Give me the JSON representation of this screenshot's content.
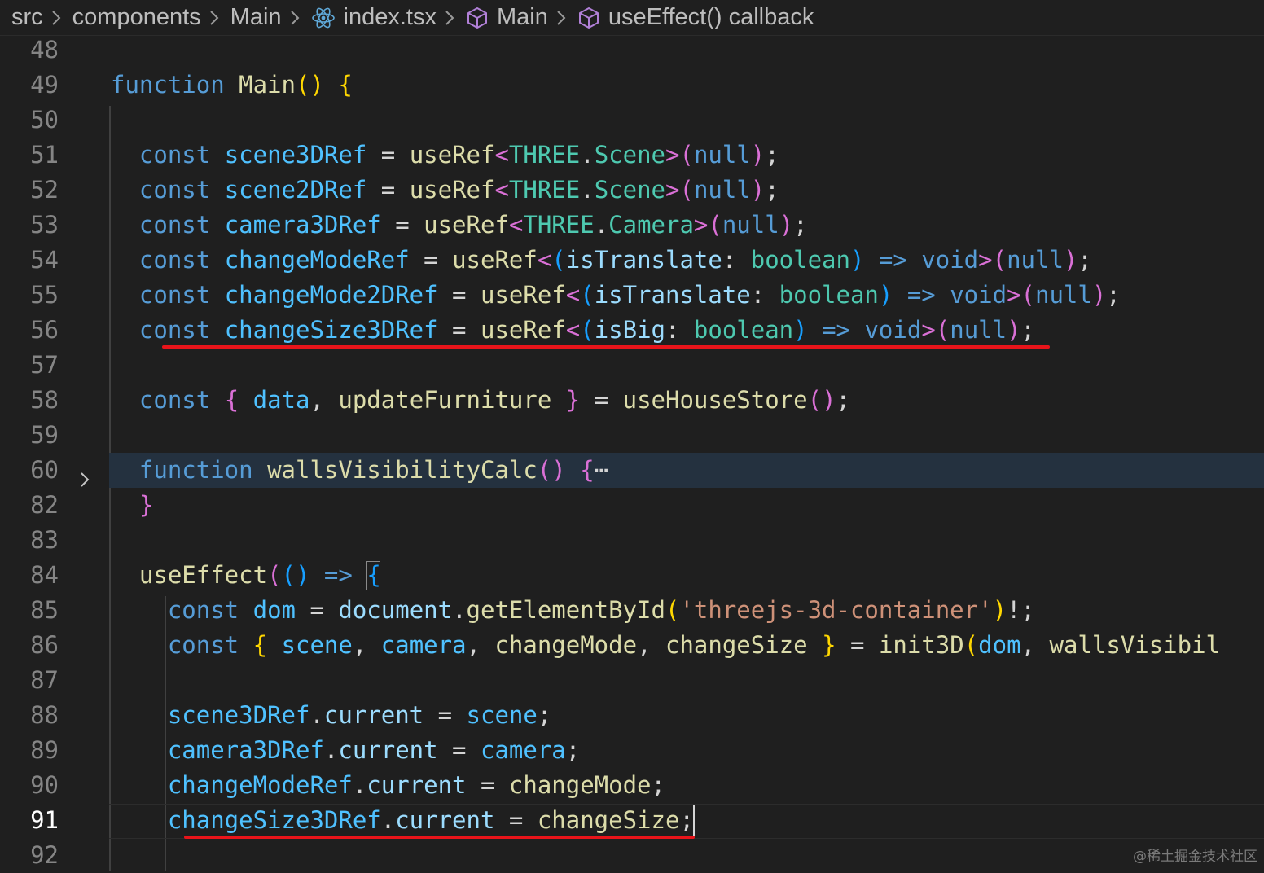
{
  "breadcrumb": {
    "items": [
      "src",
      "components",
      "Main",
      "index.tsx",
      "Main",
      "useEffect() callback"
    ]
  },
  "editor": {
    "lines": [
      {
        "num": "48",
        "tokens": []
      },
      {
        "num": "49",
        "tokens": [
          [
            "k",
            "function "
          ],
          [
            "f",
            "Main"
          ],
          [
            "b1",
            "()"
          ],
          [
            "p",
            " "
          ],
          [
            "b1",
            "{"
          ]
        ]
      },
      {
        "num": "50",
        "tokens": []
      },
      {
        "num": "51",
        "tokens": [
          [
            "p",
            "  "
          ],
          [
            "k",
            "const "
          ],
          [
            "c",
            "scene3DRef"
          ],
          [
            "p",
            " = "
          ],
          [
            "f",
            "useRef"
          ],
          [
            "b2",
            "<"
          ],
          [
            "t",
            "THREE"
          ],
          [
            "p",
            "."
          ],
          [
            "t",
            "Scene"
          ],
          [
            "b2",
            ">("
          ],
          [
            "k",
            "null"
          ],
          [
            "b2",
            ")"
          ],
          [
            "p",
            ";"
          ]
        ]
      },
      {
        "num": "52",
        "tokens": [
          [
            "p",
            "  "
          ],
          [
            "k",
            "const "
          ],
          [
            "c",
            "scene2DRef"
          ],
          [
            "p",
            " = "
          ],
          [
            "f",
            "useRef"
          ],
          [
            "b2",
            "<"
          ],
          [
            "t",
            "THREE"
          ],
          [
            "p",
            "."
          ],
          [
            "t",
            "Scene"
          ],
          [
            "b2",
            ">("
          ],
          [
            "k",
            "null"
          ],
          [
            "b2",
            ")"
          ],
          [
            "p",
            ";"
          ]
        ]
      },
      {
        "num": "53",
        "tokens": [
          [
            "p",
            "  "
          ],
          [
            "k",
            "const "
          ],
          [
            "c",
            "camera3DRef"
          ],
          [
            "p",
            " = "
          ],
          [
            "f",
            "useRef"
          ],
          [
            "b2",
            "<"
          ],
          [
            "t",
            "THREE"
          ],
          [
            "p",
            "."
          ],
          [
            "t",
            "Camera"
          ],
          [
            "b2",
            ">("
          ],
          [
            "k",
            "null"
          ],
          [
            "b2",
            ")"
          ],
          [
            "p",
            ";"
          ]
        ]
      },
      {
        "num": "54",
        "tokens": [
          [
            "p",
            "  "
          ],
          [
            "k",
            "const "
          ],
          [
            "c",
            "changeModeRef"
          ],
          [
            "p",
            " = "
          ],
          [
            "f",
            "useRef"
          ],
          [
            "b2",
            "<"
          ],
          [
            "b3",
            "("
          ],
          [
            "v",
            "isTranslate"
          ],
          [
            "p",
            ": "
          ],
          [
            "t",
            "boolean"
          ],
          [
            "b3",
            ")"
          ],
          [
            "p",
            " "
          ],
          [
            "k",
            "=>"
          ],
          [
            "p",
            " "
          ],
          [
            "k",
            "void"
          ],
          [
            "b2",
            ">("
          ],
          [
            "k",
            "null"
          ],
          [
            "b2",
            ")"
          ],
          [
            "p",
            ";"
          ]
        ]
      },
      {
        "num": "55",
        "tokens": [
          [
            "p",
            "  "
          ],
          [
            "k",
            "const "
          ],
          [
            "c",
            "changeMode2DRef"
          ],
          [
            "p",
            " = "
          ],
          [
            "f",
            "useRef"
          ],
          [
            "b2",
            "<"
          ],
          [
            "b3",
            "("
          ],
          [
            "v",
            "isTranslate"
          ],
          [
            "p",
            ": "
          ],
          [
            "t",
            "boolean"
          ],
          [
            "b3",
            ")"
          ],
          [
            "p",
            " "
          ],
          [
            "k",
            "=>"
          ],
          [
            "p",
            " "
          ],
          [
            "k",
            "void"
          ],
          [
            "b2",
            ">("
          ],
          [
            "k",
            "null"
          ],
          [
            "b2",
            ")"
          ],
          [
            "p",
            ";"
          ]
        ]
      },
      {
        "num": "56",
        "tokens": [
          [
            "p",
            "  "
          ],
          [
            "k",
            "const "
          ],
          [
            "c",
            "changeSize3DRef"
          ],
          [
            "p",
            " = "
          ],
          [
            "f",
            "useRef"
          ],
          [
            "b2",
            "<"
          ],
          [
            "b3",
            "("
          ],
          [
            "v",
            "isBig"
          ],
          [
            "p",
            ": "
          ],
          [
            "t",
            "boolean"
          ],
          [
            "b3",
            ")"
          ],
          [
            "p",
            " "
          ],
          [
            "k",
            "=>"
          ],
          [
            "p",
            " "
          ],
          [
            "k",
            "void"
          ],
          [
            "b2",
            ">("
          ],
          [
            "k",
            "null"
          ],
          [
            "b2",
            ")"
          ],
          [
            "p",
            ";"
          ]
        ]
      },
      {
        "num": "57",
        "tokens": []
      },
      {
        "num": "58",
        "tokens": [
          [
            "p",
            "  "
          ],
          [
            "k",
            "const "
          ],
          [
            "b2",
            "{"
          ],
          [
            "p",
            " "
          ],
          [
            "c",
            "data"
          ],
          [
            "p",
            ", "
          ],
          [
            "f",
            "updateFurniture"
          ],
          [
            "p",
            " "
          ],
          [
            "b2",
            "}"
          ],
          [
            "p",
            " = "
          ],
          [
            "f",
            "useHouseStore"
          ],
          [
            "b2",
            "()"
          ],
          [
            "p",
            ";"
          ]
        ]
      },
      {
        "num": "59",
        "tokens": []
      },
      {
        "num": "60",
        "tokens": [
          [
            "p",
            "  "
          ],
          [
            "k",
            "function "
          ],
          [
            "f",
            "wallsVisibilityCalc"
          ],
          [
            "b2",
            "()"
          ],
          [
            "p",
            " "
          ],
          [
            "b2",
            "{"
          ],
          [
            "p",
            "⋯"
          ]
        ]
      },
      {
        "num": "82",
        "tokens": [
          [
            "p",
            "  "
          ],
          [
            "b2",
            "}"
          ]
        ]
      },
      {
        "num": "83",
        "tokens": []
      },
      {
        "num": "84",
        "tokens": [
          [
            "p",
            "  "
          ],
          [
            "f",
            "useEffect"
          ],
          [
            "b2",
            "("
          ],
          [
            "b3",
            "()"
          ],
          [
            "p",
            " "
          ],
          [
            "k",
            "=>"
          ],
          [
            "p",
            " "
          ],
          [
            "b3",
            "{"
          ]
        ]
      },
      {
        "num": "85",
        "tokens": [
          [
            "p",
            "    "
          ],
          [
            "k",
            "const "
          ],
          [
            "c",
            "dom"
          ],
          [
            "p",
            " = "
          ],
          [
            "v",
            "document"
          ],
          [
            "p",
            "."
          ],
          [
            "f",
            "getElementById"
          ],
          [
            "b1",
            "("
          ],
          [
            "s",
            "'threejs-3d-container'"
          ],
          [
            "b1",
            ")"
          ],
          [
            "p",
            "!;"
          ]
        ]
      },
      {
        "num": "86",
        "tokens": [
          [
            "p",
            "    "
          ],
          [
            "k",
            "const "
          ],
          [
            "b1",
            "{"
          ],
          [
            "p",
            " "
          ],
          [
            "c",
            "scene"
          ],
          [
            "p",
            ", "
          ],
          [
            "c",
            "camera"
          ],
          [
            "p",
            ", "
          ],
          [
            "f",
            "changeMode"
          ],
          [
            "p",
            ", "
          ],
          [
            "f",
            "changeSize"
          ],
          [
            "p",
            " "
          ],
          [
            "b1",
            "}"
          ],
          [
            "p",
            " = "
          ],
          [
            "f",
            "init3D"
          ],
          [
            "b1",
            "("
          ],
          [
            "c",
            "dom"
          ],
          [
            "p",
            ", "
          ],
          [
            "f",
            "wallsVisibil"
          ]
        ]
      },
      {
        "num": "87",
        "tokens": []
      },
      {
        "num": "88",
        "tokens": [
          [
            "p",
            "    "
          ],
          [
            "c",
            "scene3DRef"
          ],
          [
            "p",
            "."
          ],
          [
            "v",
            "current"
          ],
          [
            "p",
            " = "
          ],
          [
            "c",
            "scene"
          ],
          [
            "p",
            ";"
          ]
        ]
      },
      {
        "num": "89",
        "tokens": [
          [
            "p",
            "    "
          ],
          [
            "c",
            "camera3DRef"
          ],
          [
            "p",
            "."
          ],
          [
            "v",
            "current"
          ],
          [
            "p",
            " = "
          ],
          [
            "c",
            "camera"
          ],
          [
            "p",
            ";"
          ]
        ]
      },
      {
        "num": "90",
        "tokens": [
          [
            "p",
            "    "
          ],
          [
            "c",
            "changeModeRef"
          ],
          [
            "p",
            "."
          ],
          [
            "v",
            "current"
          ],
          [
            "p",
            " = "
          ],
          [
            "f",
            "changeMode"
          ],
          [
            "p",
            ";"
          ]
        ]
      },
      {
        "num": "91",
        "tokens": [
          [
            "p",
            "    "
          ],
          [
            "c",
            "changeSize3DRef"
          ],
          [
            "p",
            "."
          ],
          [
            "v",
            "current"
          ],
          [
            "p",
            " = "
          ],
          [
            "f",
            "changeSize"
          ],
          [
            "p",
            ";"
          ]
        ]
      },
      {
        "num": "92",
        "tokens": []
      }
    ],
    "active_line": "91",
    "highlighted_line": "60",
    "folded_line": "60",
    "underlined_lines": [
      "56",
      "91"
    ]
  },
  "watermark": "@稀土掘金技术社区",
  "colors": {
    "background": "#1f1f1f",
    "keyword": "#569cd6",
    "function": "#dcdcaa",
    "variable": "#9cdcfe",
    "constant": "#4fc1ff",
    "type": "#4ec9b0",
    "string": "#ce9178",
    "annotation_underline": "#e8141a"
  }
}
